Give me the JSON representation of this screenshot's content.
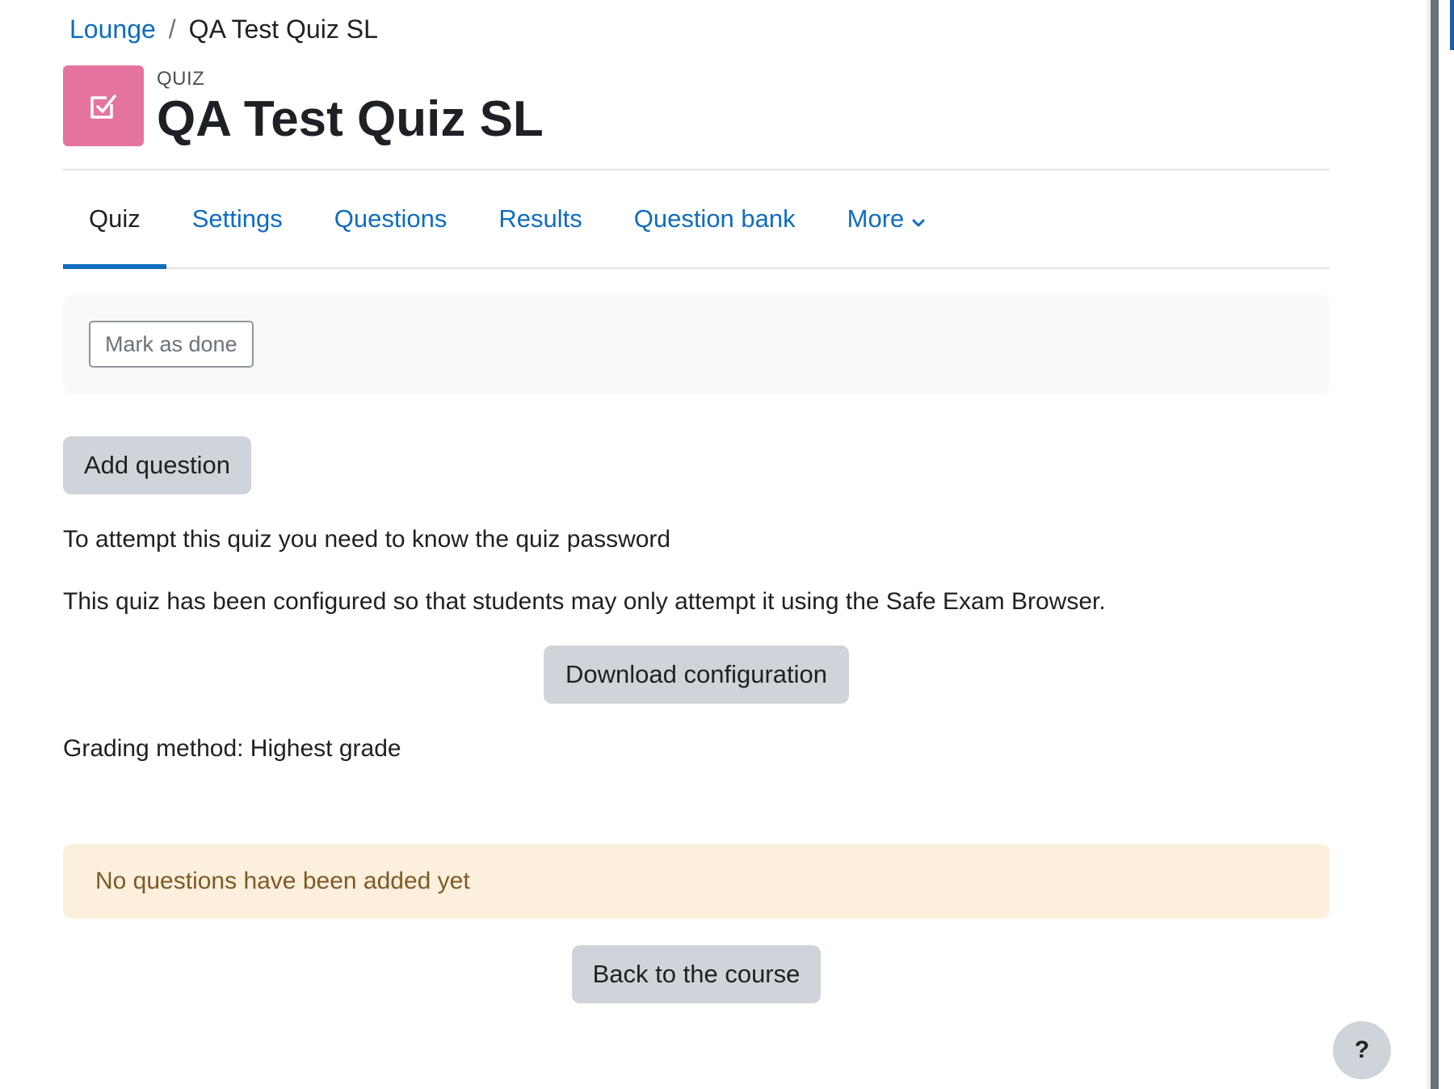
{
  "breadcrumb": {
    "parent": "Lounge",
    "separator": "/",
    "current": "QA Test Quiz SL"
  },
  "header": {
    "activity_type": "QUIZ",
    "title": "QA Test Quiz SL",
    "icon": "quiz-checkbox-icon",
    "icon_color": "#e5739f"
  },
  "tabs": [
    {
      "label": "Quiz",
      "active": true
    },
    {
      "label": "Settings",
      "active": false
    },
    {
      "label": "Questions",
      "active": false
    },
    {
      "label": "Results",
      "active": false
    },
    {
      "label": "Question bank",
      "active": false
    },
    {
      "label": "More",
      "active": false,
      "icon": "chevron-down-icon"
    }
  ],
  "completion": {
    "mark_done_label": "Mark as done"
  },
  "actions": {
    "add_question_label": "Add question",
    "download_config_label": "Download configuration",
    "back_course_label": "Back to the course"
  },
  "info": {
    "password_notice": "To attempt this quiz you need to know the quiz password",
    "seb_notice": "This quiz has been configured so that students may only attempt it using the Safe Exam Browser.",
    "grading_method": "Grading method: Highest grade"
  },
  "alert": {
    "message": "No questions have been added yet"
  },
  "help": {
    "label": "?"
  },
  "colors": {
    "link": "#0f6cbf",
    "accent": "#0f6cbf",
    "warning_bg": "#fcefdc",
    "warning_text": "#7d5a29",
    "button_secondary": "#ced4da"
  }
}
